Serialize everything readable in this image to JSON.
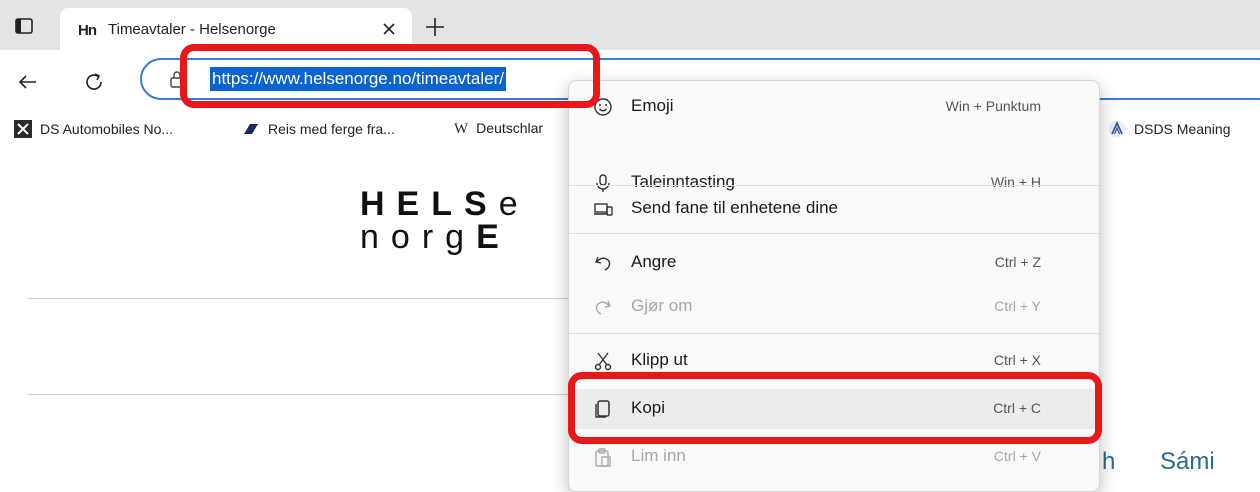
{
  "tab": {
    "favicon": "Hn",
    "title": "Timeavtaler - Helsenorge"
  },
  "address_bar": {
    "url": "https://www.helsenorge.no/timeavtaler/"
  },
  "bookmarks": [
    {
      "label": "DS Automobiles No...",
      "icon": "ds-logo-icon"
    },
    {
      "label": "Reis med ferge fra...",
      "icon": "ferry-icon"
    },
    {
      "label": "Deutschlar",
      "icon": "wikipedia-icon",
      "icon_glyph": "W"
    },
    {
      "label": "DSDS Meaning",
      "icon": "triangle-logo-icon"
    }
  ],
  "logo": {
    "line1_bold": "HELS",
    "line1_light": "e",
    "line2_light": "norg",
    "line2_bold": "E"
  },
  "language_links": [
    "h",
    "Sámi"
  ],
  "context_menu": {
    "items": [
      {
        "label": "Emoji",
        "shortcut": "Win + Punktum",
        "icon": "emoji-icon",
        "enabled": true
      },
      {
        "label": "Taleinntasting",
        "shortcut": "Win + H",
        "icon": "microphone-icon",
        "enabled": true
      },
      {
        "label": "Send fane til enhetene dine",
        "shortcut": "",
        "icon": "devices-icon",
        "enabled": true
      },
      {
        "label": "Angre",
        "shortcut": "Ctrl + Z",
        "icon": "undo-icon",
        "enabled": true
      },
      {
        "label": "Gjør om",
        "shortcut": "Ctrl + Y",
        "icon": "redo-icon",
        "enabled": false
      },
      {
        "label": "Klipp ut",
        "shortcut": "Ctrl + X",
        "icon": "cut-icon",
        "enabled": true
      },
      {
        "label": "Kopi",
        "shortcut": "Ctrl + C",
        "icon": "copy-icon",
        "enabled": true,
        "highlighted": true
      },
      {
        "label": "Lim inn",
        "shortcut": "Ctrl + V",
        "icon": "paste-icon",
        "enabled": false
      }
    ]
  },
  "colors": {
    "highlight_red": "#e8171a",
    "selection_blue": "#0b63cf",
    "link_teal": "#2a6b8a"
  }
}
